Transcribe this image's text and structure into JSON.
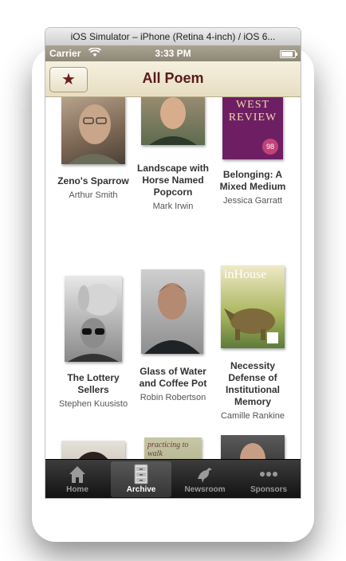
{
  "window": {
    "title": "iOS Simulator – iPhone (Retina 4-inch) / iOS 6..."
  },
  "status": {
    "carrier": "Carrier",
    "time": "3:33 PM",
    "battery_level": 0.85
  },
  "nav": {
    "title": "All Poem"
  },
  "poems": [
    {
      "title": "Zeno's Sparrow",
      "author": "Arthur Smith"
    },
    {
      "title": "Landscape with Horse Named Popcorn",
      "author": "Mark Irwin"
    },
    {
      "title": "Belonging: A Mixed Medium",
      "author": "Jessica Garratt"
    },
    {
      "title": "The Lottery Sellers",
      "author": "Stephen Kuusisto"
    },
    {
      "title": "Glass of Water and Coffee Pot",
      "author": "Robin Robertson"
    },
    {
      "title": "Necessity Defense of Institutional Memory",
      "author": "Camille Rankine"
    }
  ],
  "covers": {
    "west_review": "WEST REVIEW",
    "west_review_issue": "98",
    "pinhouse": "inHouse",
    "practicing": "practicing to walk"
  },
  "tabs": [
    {
      "label": "Home",
      "icon": "home-icon"
    },
    {
      "label": "Archive",
      "icon": "archive-icon"
    },
    {
      "label": "Newsroom",
      "icon": "bird-icon"
    },
    {
      "label": "Sponsors",
      "icon": "more-icon"
    }
  ],
  "colors": {
    "nav_title": "#5a1a1a",
    "star": "#6b1f1b",
    "nav_bg": "#efe7d1"
  }
}
